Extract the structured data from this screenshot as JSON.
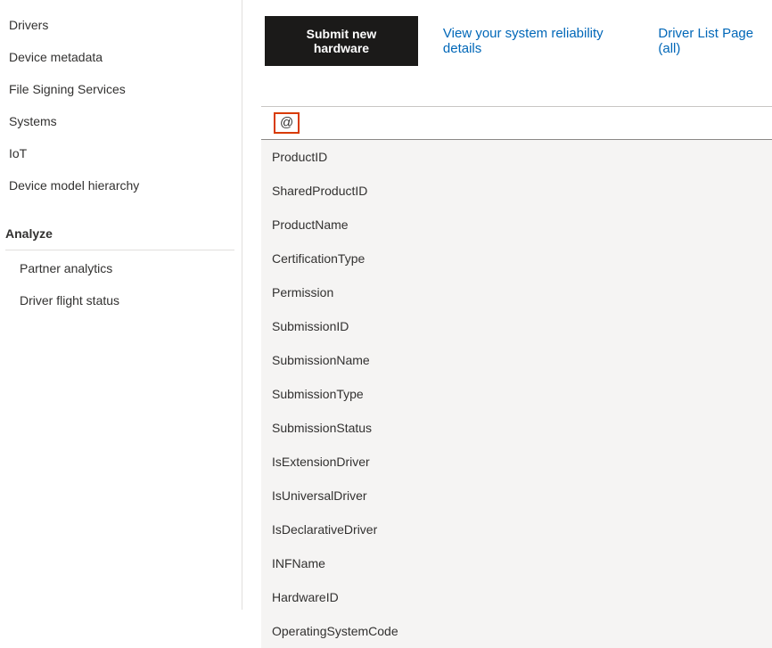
{
  "sidebar": {
    "items": [
      {
        "label": "Drivers"
      },
      {
        "label": "Device metadata"
      },
      {
        "label": "File Signing Services"
      },
      {
        "label": "Systems"
      },
      {
        "label": "IoT"
      },
      {
        "label": "Device model hierarchy"
      }
    ],
    "section_header": "Analyze",
    "subitems": [
      {
        "label": "Partner analytics"
      },
      {
        "label": "Driver flight status"
      }
    ]
  },
  "action_bar": {
    "submit_label": "Submit new hardware",
    "reliability_link": "View your system reliability details",
    "driver_list_link": "Driver List Page (all)"
  },
  "search": {
    "value": "@"
  },
  "dropdown": {
    "items": [
      "ProductID",
      "SharedProductID",
      "ProductName",
      "CertificationType",
      "Permission",
      "SubmissionID",
      "SubmissionName",
      "SubmissionType",
      "SubmissionStatus",
      "IsExtensionDriver",
      "IsUniversalDriver",
      "IsDeclarativeDriver",
      "INFName",
      "HardwareID",
      "OperatingSystemCode"
    ]
  }
}
